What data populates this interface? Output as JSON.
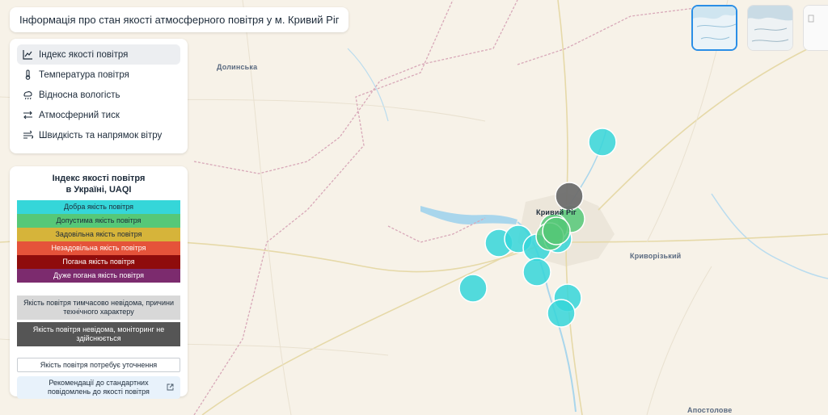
{
  "page_title": "Інформація про стан якості атмосферного повітря у м. Кривий Ріг",
  "layers": [
    {
      "label": "Індекс якості повітря",
      "icon": "chart-icon",
      "active": true
    },
    {
      "label": "Температура повітря",
      "icon": "thermometer-icon",
      "active": false
    },
    {
      "label": "Відносна вологість",
      "icon": "humidity-icon",
      "active": false
    },
    {
      "label": "Атмосферний тиск",
      "icon": "pressure-arrows-icon",
      "active": false
    },
    {
      "label": "Швидкість та напрямок вітру",
      "icon": "wind-icon",
      "active": false
    }
  ],
  "legend": {
    "title_line1": "Індекс якості повітря",
    "title_line2": "в Україні, UAQI",
    "levels": [
      {
        "label": "Добра якість повітря",
        "color": "#35d6d9",
        "text_color": "#1d2b3a"
      },
      {
        "label": "Допустима якість повітря",
        "color": "#56c878",
        "text_color": "#1d2b3a"
      },
      {
        "label": "Задовільна якість повітря",
        "color": "#d6b43a",
        "text_color": "#1d2b3a"
      },
      {
        "label": "Незадовільна якість повітря",
        "color": "#e5533a",
        "text_color": "#ffffff"
      },
      {
        "label": "Погана якість повітря",
        "color": "#8f0c0c",
        "text_color": "#ffffff"
      },
      {
        "label": "Дуже погана якість повітря",
        "color": "#7c2b6e",
        "text_color": "#ffffff"
      }
    ],
    "unavailable_technical": "Якість повітря тимчасово невідома, причини технічного характеру",
    "unavailable_technical_color": "#d8d8d8",
    "unknown_no_monitoring": "Якість повітря невідома, моніторинг не здійснюється",
    "unknown_no_monitoring_color": "#555555",
    "needs_clarification": "Якість повітря потребує уточнення",
    "recommendations_link": "Рекомендації до стандартних повідомлень до якості повітря"
  },
  "map_labels": {
    "dolynska": "Долинська",
    "kryvyi_rih": "Кривий Ріг",
    "kryvorizkyi": "Криворізький",
    "apostolove": "Апостолове"
  },
  "colors": {
    "good": "#35d6d9",
    "acceptable": "#56c878",
    "unknown": "#6e6e6e",
    "water": "#a9d6ec",
    "accent": "#2a8ee6"
  },
  "stations": [
    {
      "status": "good"
    },
    {
      "status": "good"
    },
    {
      "status": "good"
    },
    {
      "status": "good"
    },
    {
      "status": "good"
    },
    {
      "status": "good"
    },
    {
      "status": "good"
    },
    {
      "status": "good"
    },
    {
      "status": "good"
    },
    {
      "status": "acceptable"
    },
    {
      "status": "acceptable"
    },
    {
      "status": "acceptable"
    },
    {
      "status": "acceptable"
    },
    {
      "status": "unknown"
    }
  ],
  "basemaps": [
    {
      "name": "light-basemap",
      "active": true
    },
    {
      "name": "terrain-basemap",
      "active": false
    },
    {
      "name": "plain-basemap",
      "active": false
    }
  ]
}
